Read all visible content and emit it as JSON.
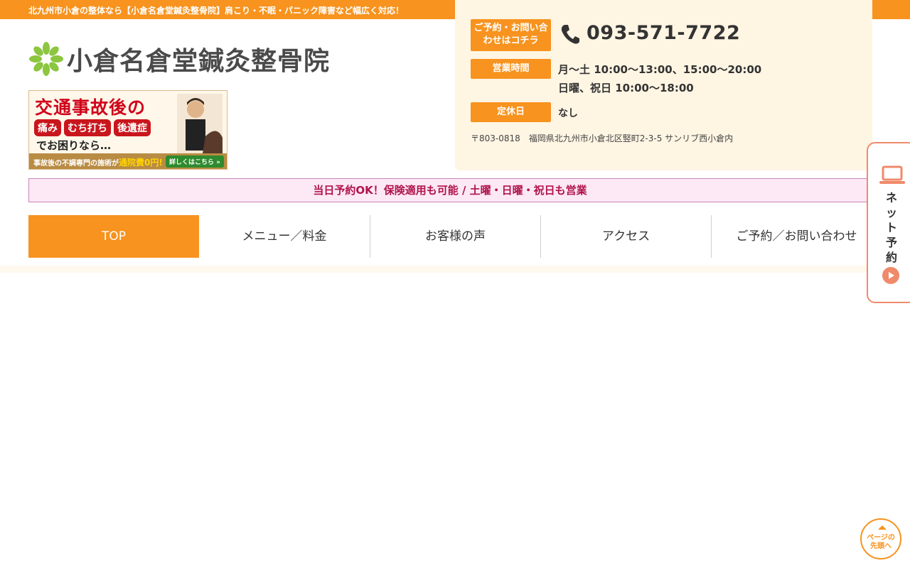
{
  "topbar": {
    "text": "北九州市小倉の整体なら【小倉名倉堂鍼灸整骨院】肩こり・不眠・パニック障害など幅広く対応！"
  },
  "logo": {
    "text": "小倉名倉堂鍼灸整骨院",
    "icon": "leaf-icon"
  },
  "banner": {
    "headline": "交通事故後の",
    "tags": [
      "痛み",
      "むち打ち",
      "後遺症"
    ],
    "sub": "でお困りなら…",
    "foot_text": "事故後の不調専門の施術が",
    "foot_strong": "通院費0円!",
    "foot_button": "詳しくはこちら »"
  },
  "contact": {
    "label": "ご予約・お問い合わせはコチラ",
    "phone": "093-571-7722",
    "hours_label": "営業時間",
    "hours_line1": "月〜土 10:00〜13:00、15:00〜20:00",
    "hours_line2": "日曜、祝日 10:00〜18:00",
    "closed_label": "定休日",
    "closed_value": "なし",
    "address": "〒803-0818　福岡県北九州市小倉北区竪町2-3-5 サンリブ西小倉内"
  },
  "notice": {
    "text": "当日予約OK！保険適用も可能 / 土曜・日曜・祝日も営業"
  },
  "nav": {
    "items": [
      {
        "label": "TOP",
        "active": true
      },
      {
        "label": "メニュー／料金"
      },
      {
        "label": "お客様の声"
      },
      {
        "label": "アクセス"
      },
      {
        "label": "ご予約／お問い合わせ"
      }
    ]
  },
  "side_tab": {
    "label": "ネット予約",
    "icon": "laptop-icon"
  },
  "page_top": {
    "label": "ページの先頭へ"
  },
  "colors": {
    "accent": "#f7931e",
    "notice_bg": "#fde8f5",
    "notice_text": "#b0144a",
    "info_bg": "#fff5e3"
  }
}
